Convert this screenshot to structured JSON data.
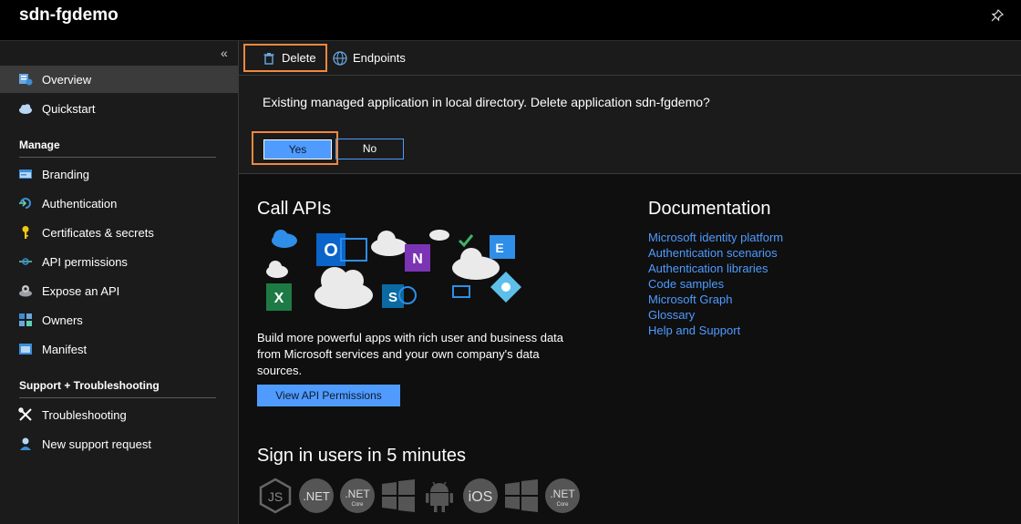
{
  "header": {
    "title": "sdn-fgdemo",
    "pin_icon": "pin-icon"
  },
  "sidebar": {
    "collapse_icon": "«",
    "items_top": [
      {
        "label": "Overview",
        "icon": "overview-icon",
        "active": true
      },
      {
        "label": "Quickstart",
        "icon": "quickstart-cloud-icon"
      }
    ],
    "manage_title": "Manage",
    "manage_items": [
      {
        "label": "Branding",
        "icon": "branding-icon"
      },
      {
        "label": "Authentication",
        "icon": "authentication-icon"
      },
      {
        "label": "Certificates & secrets",
        "icon": "key-icon"
      },
      {
        "label": "API permissions",
        "icon": "api-permissions-icon"
      },
      {
        "label": "Expose an API",
        "icon": "gear-cloud-icon"
      },
      {
        "label": "Owners",
        "icon": "owners-icon"
      },
      {
        "label": "Manifest",
        "icon": "manifest-icon"
      }
    ],
    "support_title": "Support + Troubleshooting",
    "support_items": [
      {
        "label": "Troubleshooting",
        "icon": "wrench-icon"
      },
      {
        "label": "New support request",
        "icon": "support-person-icon"
      }
    ]
  },
  "toolbar": {
    "delete_label": "Delete",
    "endpoints_label": "Endpoints"
  },
  "confirm": {
    "message": "Existing managed application in local directory. Delete application sdn-fgdemo?",
    "yes_label": "Yes",
    "no_label": "No"
  },
  "call_apis": {
    "title": "Call APIs",
    "description": "Build more powerful apps with rich user and business data from Microsoft services and your own company's data sources.",
    "button_label": "View API Permissions"
  },
  "documentation": {
    "title": "Documentation",
    "links": [
      "Microsoft identity platform",
      "Authentication scenarios",
      "Authentication libraries",
      "Code samples",
      "Microsoft Graph",
      "Glossary",
      "Help and Support"
    ]
  },
  "sign_in": {
    "title": "Sign in users in 5 minutes",
    "platforms": [
      {
        "icon": "nodejs-icon",
        "text": "JS"
      },
      {
        "icon": "dotnet-icon",
        "text": ".NET"
      },
      {
        "icon": "dotnet-core-icon",
        "text": ".NET",
        "sub": "Core"
      },
      {
        "icon": "windows-icon",
        "text": ""
      },
      {
        "icon": "android-icon",
        "text": ""
      },
      {
        "icon": "ios-icon",
        "text": "iOS"
      },
      {
        "icon": "windows-icon",
        "text": ""
      },
      {
        "icon": "dotnet-core-icon",
        "text": ".NET",
        "sub": "Core"
      }
    ]
  },
  "colors": {
    "accent": "#4f9bff",
    "highlight": "#f0883e",
    "background": "#0f0f0f",
    "panel": "#1b1b1b"
  }
}
